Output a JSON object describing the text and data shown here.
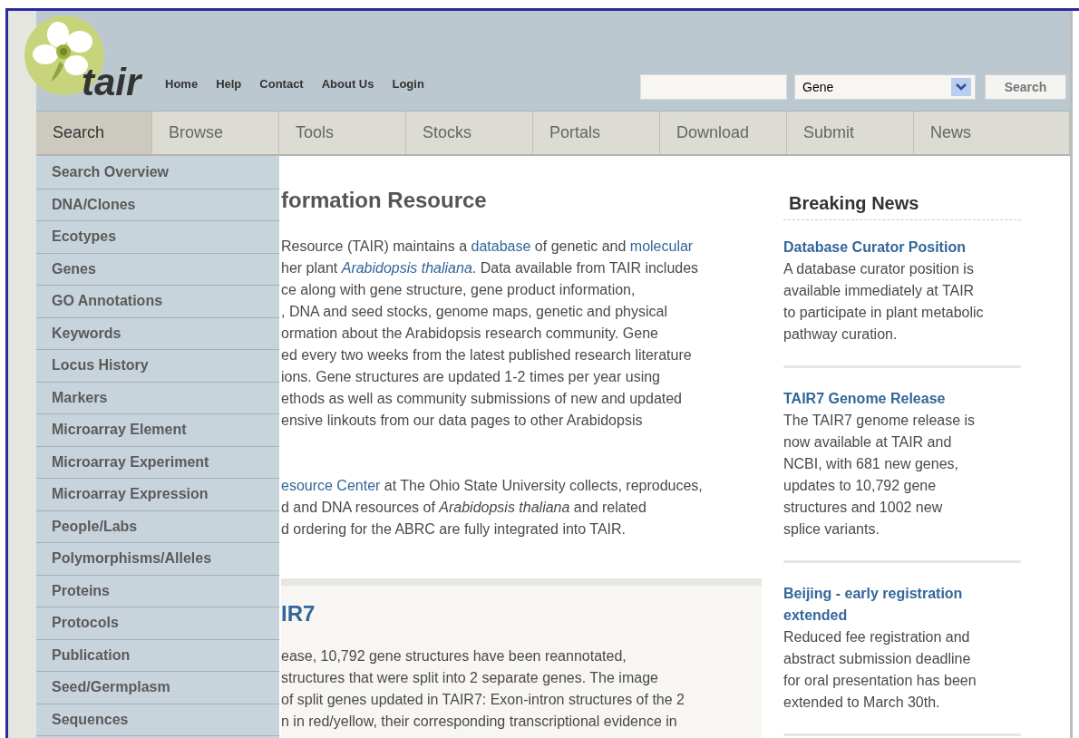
{
  "logo": {
    "text": "tair"
  },
  "top_links": [
    "Home",
    "Help",
    "Contact",
    "About Us",
    "Login"
  ],
  "search": {
    "select": "Gene",
    "button": "Search"
  },
  "tabs": [
    {
      "label": "Search",
      "selected": true
    },
    {
      "label": "Browse",
      "selected": false
    },
    {
      "label": "Tools",
      "selected": false
    },
    {
      "label": "Stocks",
      "selected": false
    },
    {
      "label": "Portals",
      "selected": false
    },
    {
      "label": "Download",
      "selected": false
    },
    {
      "label": "Submit",
      "selected": false
    },
    {
      "label": "News",
      "selected": false
    }
  ],
  "menu": [
    "Search Overview",
    "DNA/Clones",
    "Ecotypes",
    "Genes",
    "GO Annotations",
    "Keywords",
    "Locus History",
    "Markers",
    "Microarray Element",
    "Microarray Experiment",
    "Microarray Expression",
    "People/Labs",
    "Polymorphisms/Alleles",
    "Proteins",
    "Protocols",
    "Publication",
    "Seed/Germplasm",
    "Sequences"
  ],
  "main": {
    "heading": "formation Resource",
    "paragraphs": [
      [
        [
          {
            "text": "Resource (TAIR) maintains a ",
            "kind": "text"
          },
          {
            "text": "database",
            "kind": "link"
          },
          {
            "text": " of genetic and ",
            "kind": "text"
          },
          {
            "text": "molecular",
            "kind": "link"
          }
        ],
        [
          {
            "text": "her plant ",
            "kind": "text"
          },
          {
            "text": "Arabidopsis thaliana",
            "kind": "italic_link"
          },
          {
            "text": ". Data available from TAIR includes",
            "kind": "text"
          }
        ],
        [
          {
            "text": "ce along with gene structure, gene product information,",
            "kind": "text"
          }
        ],
        [
          {
            "text": ", DNA and seed stocks, genome maps, genetic and physical",
            "kind": "text"
          }
        ],
        [
          {
            "text": "ormation about the Arabidopsis research community. Gene",
            "kind": "text"
          }
        ],
        [
          {
            "text": "ed every two weeks from the latest published research literature",
            "kind": "text"
          }
        ],
        [
          {
            "text": "ions. Gene structures are updated 1-2 times per year using",
            "kind": "text"
          }
        ],
        [
          {
            "text": "ethods as well as community submissions of new and updated",
            "kind": "text"
          }
        ],
        [
          {
            "text": "ensive linkouts from our data pages to other Arabidopsis",
            "kind": "text"
          }
        ]
      ],
      [
        [
          {
            "text": "esource Center",
            "kind": "link"
          },
          {
            "text": " at The Ohio State University collects, reproduces,",
            "kind": "text"
          }
        ],
        [
          {
            "text": "d and DNA resources of ",
            "kind": "text"
          },
          {
            "text": "Arabidopsis thaliana",
            "kind": "italic"
          },
          {
            "text": " and related",
            "kind": "text"
          }
        ],
        [
          {
            "text": "d ordering for the ABRC are fully integrated into TAIR.",
            "kind": "text"
          }
        ]
      ]
    ]
  },
  "feature": {
    "heading": "IR7",
    "lines": [
      "ease, 10,792 gene structures have been reannotated,",
      "structures that were split into 2 separate genes. The image",
      "of split genes updated in TAIR7: Exon-intron structures of the 2",
      "n in red/yellow, their corresponding transcriptional evidence in"
    ]
  },
  "news": {
    "title": "Breaking News",
    "items": [
      {
        "title": "Database Curator Position",
        "body": [
          "A database curator position is",
          "available immediately at TAIR",
          "to participate in plant metabolic",
          "pathway curation."
        ]
      },
      {
        "title": "TAIR7 Genome Release",
        "body": [
          "The TAIR7 genome release is",
          "now available at TAIR and",
          "NCBI, with 681 new genes,",
          "updates to 10,792 gene",
          "structures and 1002 new",
          "splice variants."
        ]
      },
      {
        "title": "Beijing - early registration extended",
        "body": [
          "Reduced fee registration and",
          "abstract submission deadline",
          "for oral presentation has been",
          "extended to March 30th."
        ]
      }
    ]
  }
}
